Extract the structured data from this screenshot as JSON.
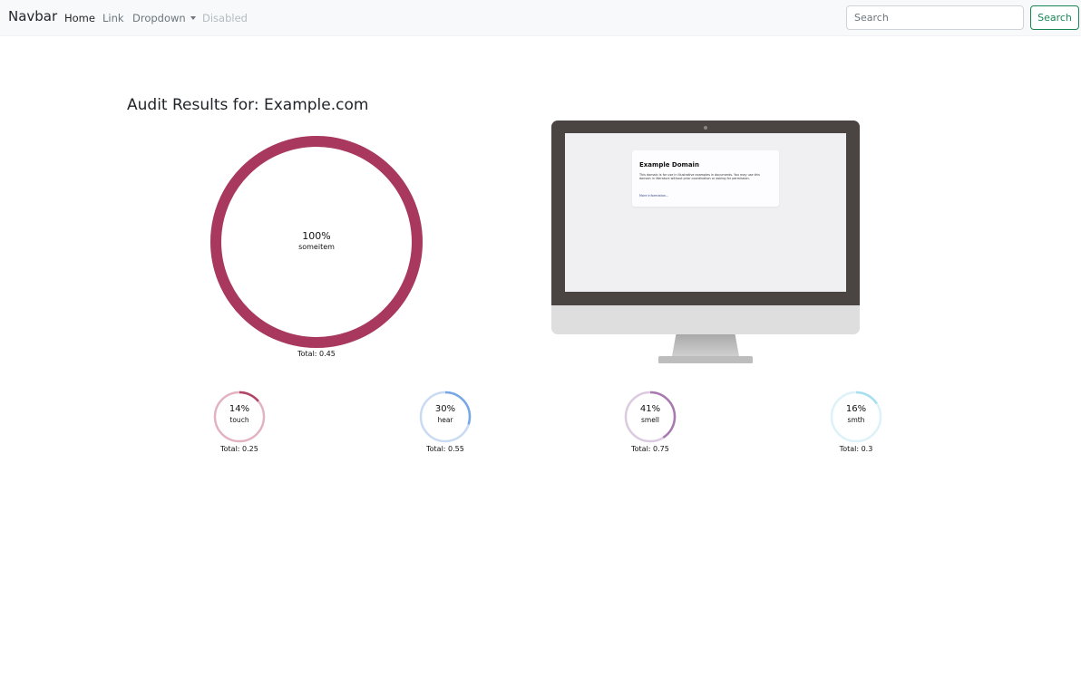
{
  "navbar": {
    "brand": "Navbar",
    "links": [
      {
        "label": "Home",
        "state": "active"
      },
      {
        "label": "Link",
        "state": "normal"
      },
      {
        "label": "Dropdown",
        "state": "normal"
      },
      {
        "label": "Disabled",
        "state": "disabled"
      }
    ],
    "search_placeholder": "Search",
    "search_button": "Search",
    "colors": {
      "button": "#198754"
    }
  },
  "title": "Audit Results for: Example.com",
  "main_gauge": {
    "percent": 100,
    "percent_text": "100%",
    "label": "someitem",
    "total_text": "Total: 0.45",
    "color": "#a8385e"
  },
  "gauges": [
    {
      "percent": 14,
      "percent_text": "14%",
      "label": "touch",
      "total_text": "Total: 0.25",
      "color": "#b04566",
      "track": "#e2b4c2"
    },
    {
      "percent": 30,
      "percent_text": "30%",
      "label": "hear",
      "total_text": "Total: 0.55",
      "color": "#76a8e8",
      "track": "#c9daf3"
    },
    {
      "percent": 41,
      "percent_text": "41%",
      "label": "smell",
      "total_text": "Total: 0.75",
      "color": "#a87ab0",
      "track": "#dccbe0"
    },
    {
      "percent": 16,
      "percent_text": "16%",
      "label": "smth",
      "total_text": "Total: 0.3",
      "color": "#a6dff0",
      "track": "#dcf2f9"
    }
  ],
  "preview": {
    "heading": "Example Domain",
    "body": "This domain is for use in illustrative examples in documents. You may use this domain in literature without prior coordination or asking for permission.",
    "link": "More information..."
  }
}
